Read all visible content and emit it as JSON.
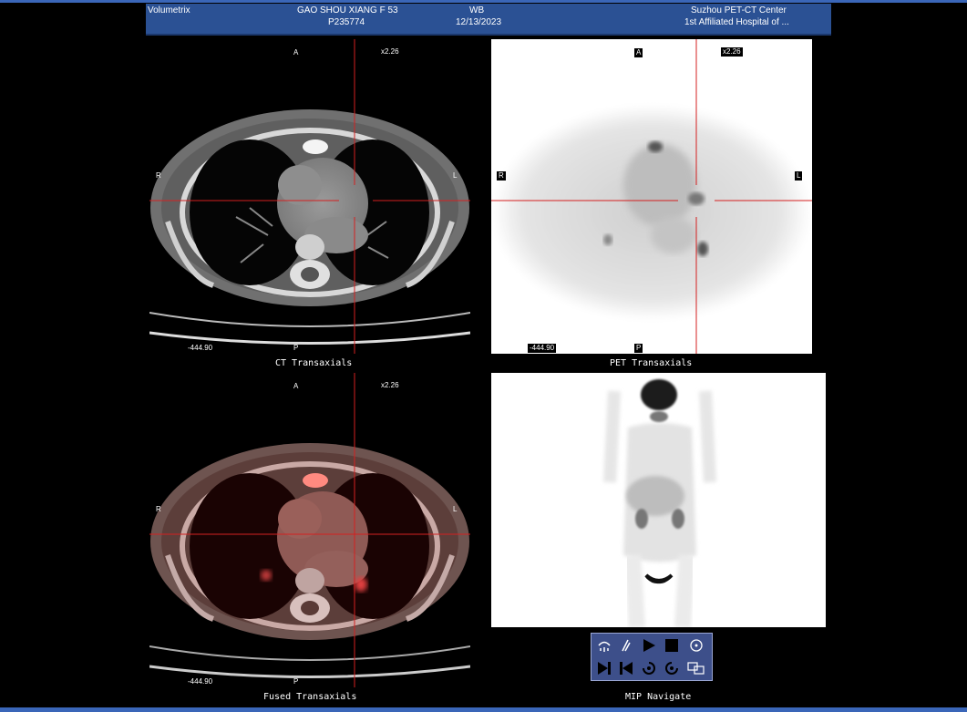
{
  "header": {
    "app": "Volumetrix",
    "patient_name": "GAO SHOU XIANG F 53",
    "patient_id": "P235774",
    "study": "WB",
    "date": "12/13/2023",
    "center": "Suzhou PET-CT Center",
    "hospital": "1st Affiliated Hospital of ..."
  },
  "viewports": {
    "ct": {
      "label": "CT Transaxials",
      "zoom": "x2.26",
      "top": "A",
      "bottom": "P",
      "left": "R",
      "right": "L",
      "slice": "-444.90"
    },
    "pet": {
      "label": "PET Transaxials",
      "zoom": "x2.26",
      "top": "A",
      "bottom": "P",
      "left": "R",
      "right": "L",
      "slice": "-444.90"
    },
    "fused": {
      "label": "Fused Transaxials",
      "zoom": "x2.26",
      "top": "A",
      "bottom": "P",
      "left": "R",
      "right": "L",
      "slice": "-444.90"
    },
    "mip": {
      "label": "MIP Navigate"
    }
  },
  "toolbar": {
    "row1": [
      "rotate-body-icon",
      "lasso-icon",
      "play-icon",
      "stop-icon",
      "target-icon"
    ],
    "row2": [
      "step-next-icon",
      "step-prev-icon",
      "spin-cw-icon",
      "spin-ccw-icon",
      "screens-icon"
    ]
  },
  "colors": {
    "header": "#2b5194",
    "frame": "#3a66b8",
    "crosshair": "#d42020"
  }
}
